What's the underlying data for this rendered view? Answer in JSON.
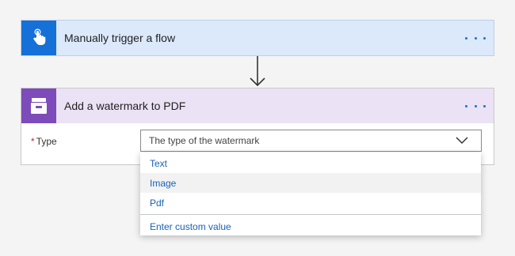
{
  "trigger_card": {
    "title": "Manually trigger a flow",
    "icon": "touch-hand-icon",
    "accent": "#1570d8"
  },
  "action_card": {
    "title": "Add a watermark to PDF",
    "icon": "file-cabinet-icon",
    "accent": "#7d4bba",
    "field": {
      "required_mark": "*",
      "label": "Type",
      "placeholder": "The type of the watermark"
    }
  },
  "dropdown": {
    "options": [
      "Text",
      "Image",
      "Pdf"
    ],
    "hovered_index": 1,
    "custom_label": "Enter custom value",
    "link_color": "#1861b8"
  }
}
